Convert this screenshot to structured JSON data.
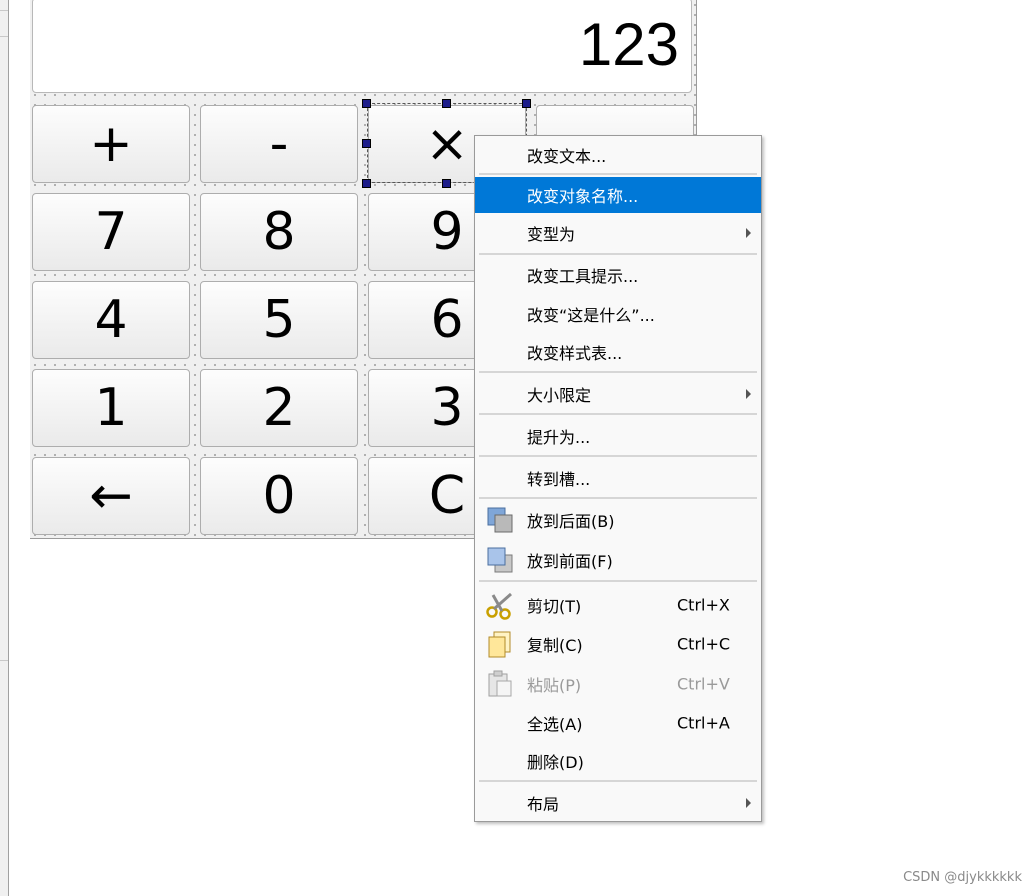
{
  "display": {
    "value": "123"
  },
  "keys": {
    "plus": "+",
    "minus": "-",
    "times": "×",
    "blank": "",
    "seven": "7",
    "eight": "8",
    "nine": "9",
    "four": "4",
    "five": "5",
    "six": "6",
    "one": "1",
    "two": "2",
    "three": "3",
    "backspace": "←",
    "zero": "0",
    "clear": "C"
  },
  "menu": {
    "items": [
      {
        "label": "改变文本..."
      },
      {
        "label": "改变对象名称..."
      },
      {
        "label": "变型为"
      },
      {
        "label": "改变工具提示..."
      },
      {
        "label": "改变“这是什么”..."
      },
      {
        "label": "改变样式表..."
      },
      {
        "label": "大小限定"
      },
      {
        "label": "提升为..."
      },
      {
        "label": "转到槽..."
      },
      {
        "label": "放到后面(B)"
      },
      {
        "label": "放到前面(F)"
      },
      {
        "label": "剪切(T)",
        "shortcut": "Ctrl+X"
      },
      {
        "label": "复制(C)",
        "shortcut": "Ctrl+C"
      },
      {
        "label": "粘贴(P)",
        "shortcut": "Ctrl+V"
      },
      {
        "label": "全选(A)",
        "shortcut": "Ctrl+A"
      },
      {
        "label": "删除(D)"
      },
      {
        "label": "布局"
      }
    ]
  },
  "icons": {
    "send_back": "send-to-back-icon",
    "bring_front": "bring-to-front-icon",
    "cut": "scissors-icon",
    "copy": "copy-icon",
    "paste": "paste-icon"
  },
  "colors": {
    "highlight": "#0078d7",
    "disabled_text": "#9a9a9a"
  },
  "watermark": "CSDN @djykkkkkk"
}
